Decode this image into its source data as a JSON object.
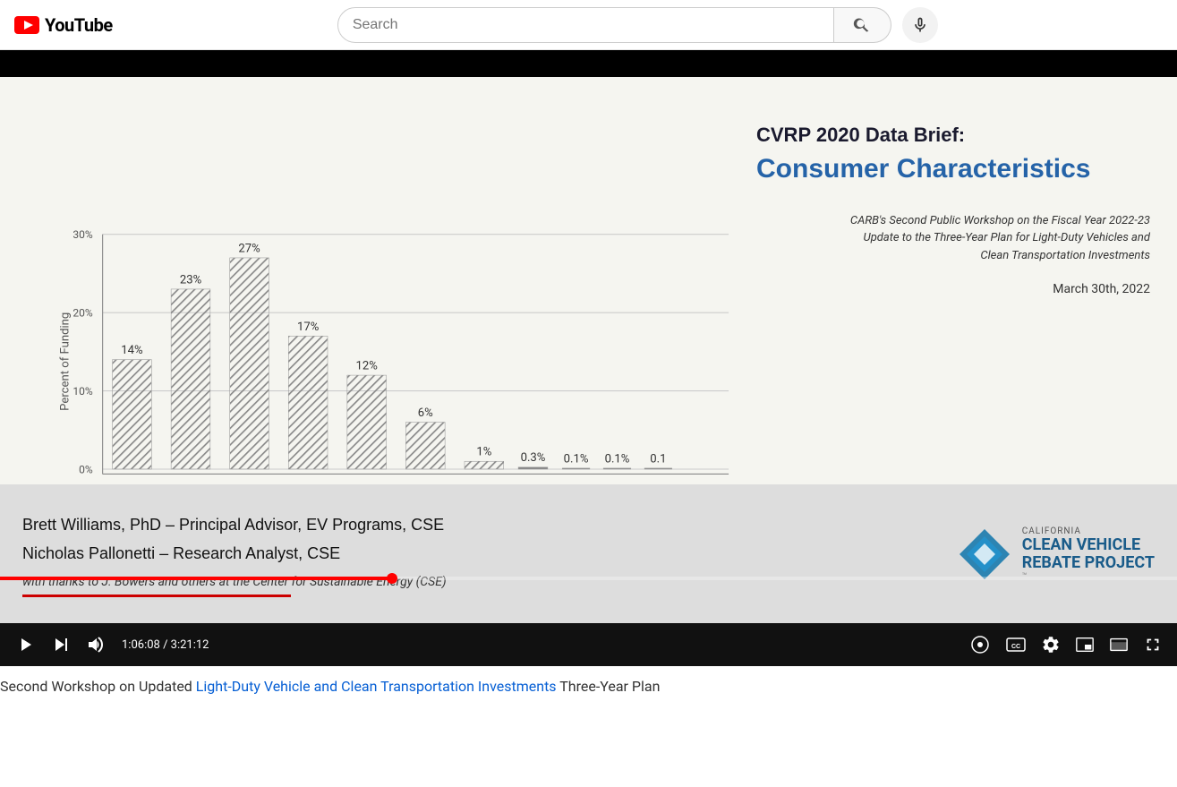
{
  "header": {
    "logo_text": "YouTube",
    "search_placeholder": "Search"
  },
  "video": {
    "top_black_bar_visible": true,
    "slide": {
      "title_main": "CVRP 2020 Data Brief:",
      "title_sub": "Consumer Characteristics",
      "description": "CARB's Second Public Workshop on the Fiscal Year 2022-23\nUpdate to the Three-Year Plan for Light-Duty Vehicles and\nClean Transportation Investments",
      "date": "March 30th, 2022",
      "y_axis_label": "Percent of Funding",
      "chart_bars": [
        {
          "label": "14%",
          "value": 14,
          "x_pct": 5
        },
        {
          "label": "23%",
          "value": 23,
          "x_pct": 15
        },
        {
          "label": "27%",
          "value": 27,
          "x_pct": 25
        },
        {
          "label": "17%",
          "value": 17,
          "x_pct": 35
        },
        {
          "label": "12%",
          "value": 12,
          "x_pct": 45
        },
        {
          "label": "6%",
          "value": 6,
          "x_pct": 55
        },
        {
          "label": "1%",
          "value": 1,
          "x_pct": 65
        },
        {
          "label": "0.3%",
          "value": 0.3,
          "x_pct": 72
        },
        {
          "label": "0.1%",
          "value": 0.1,
          "x_pct": 79
        },
        {
          "label": "0.1%",
          "value": 0.1,
          "x_pct": 86
        },
        {
          "label": "0.1",
          "value": 0.1,
          "x_pct": 93
        }
      ],
      "y_ticks": [
        "0%",
        "10%",
        "20%",
        "30%"
      ]
    },
    "bottom": {
      "presenter1": "Brett Williams, PhD – Principal Advisor, EV Programs, CSE",
      "presenter2": "Nicholas Pallonetti – Research Analyst, CSE",
      "thanks": "with thanks to J. Bowers and others at the Center for Sustainable Energy (CSE)"
    },
    "controls": {
      "time_current": "1:06:08",
      "time_total": "3:21:12",
      "progress_pct": 33.3
    },
    "page_title_parts": [
      {
        "text": "Second Workshop on Updated ",
        "link": false
      },
      {
        "text": "Light-Duty Vehicle and Clean Transportation Investments",
        "link": true
      },
      {
        "text": " Three-Year Plan",
        "link": false
      }
    ]
  },
  "cvrp": {
    "california": "CALIFORNIA",
    "clean": "CLEAN VEHICLE",
    "rebate": "REBATE PROJECT"
  }
}
